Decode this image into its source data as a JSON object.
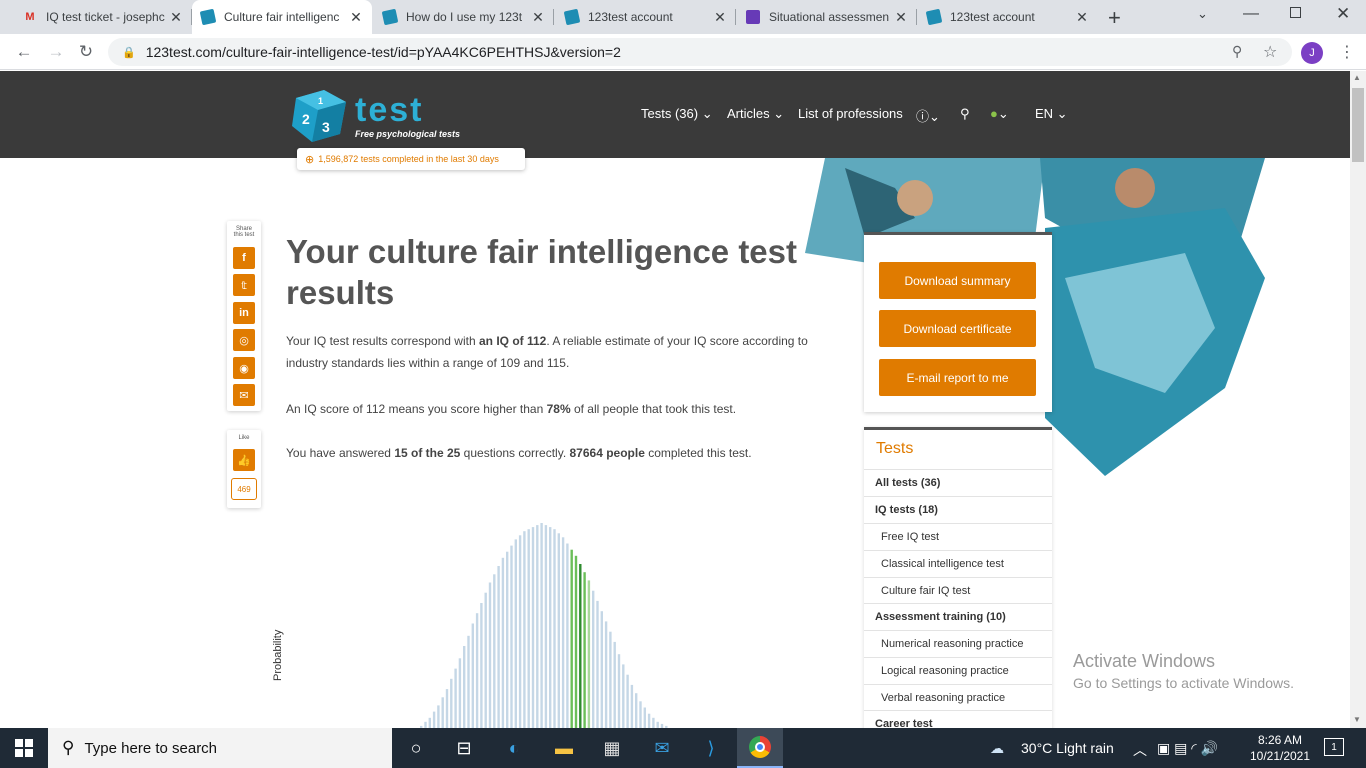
{
  "browser": {
    "tabs": [
      {
        "title": "IQ test ticket - josephc",
        "icon": "gmail-icon"
      },
      {
        "title": "Culture fair intelligenc",
        "icon": "123test-icon",
        "active": true
      },
      {
        "title": "How do I use my 123t",
        "icon": "123test-icon"
      },
      {
        "title": "123test account",
        "icon": "123test-icon"
      },
      {
        "title": "Situational assessmen",
        "icon": "forms-icon"
      },
      {
        "title": "123test account",
        "icon": "123test-icon"
      }
    ],
    "url": "123test.com/culture-fair-intelligence-test/id=pYAA4KC6PEHTHSJ&version=2",
    "profile_initial": "J"
  },
  "site": {
    "logo_text": "test",
    "logo_sub": "Free psychological tests",
    "counter": "1,596,872 tests completed in the last 30 days",
    "nav": {
      "tests": "Tests (36)",
      "articles": "Articles",
      "professions": "List of professions",
      "lang": "EN"
    }
  },
  "share": {
    "label1": "Share",
    "label2": "this test",
    "like_label": "Like",
    "like_count": "469"
  },
  "content": {
    "title": "Your culture fair intelligence test results",
    "p1_a": "Your IQ test results correspond with ",
    "p1_b": "an IQ of 112",
    "p1_c": ". A reliable estimate of your IQ score according to industry standards lies within a range of 109 and 115.",
    "p2_a": "An IQ score of 112 means you score higher than ",
    "p2_b": "78%",
    "p2_c": " of all people that took this test.",
    "p3_a": "You have answered ",
    "p3_b": "15 of the 25",
    "p3_c": " questions correctly. ",
    "p3_d": "87664 people",
    "p3_e": " completed this test.",
    "chart_ylabel": "Probability"
  },
  "buttons": {
    "download_summary": "Download summary",
    "download_certificate": "Download certificate",
    "email_report": "E-mail report to me"
  },
  "tests_panel": {
    "title": "Tests",
    "items": [
      {
        "label": "All tests (36)",
        "kind": "b"
      },
      {
        "label": "IQ tests (18)",
        "kind": "b"
      },
      {
        "label": "Free IQ test",
        "kind": "s"
      },
      {
        "label": "Classical intelligence test",
        "kind": "s"
      },
      {
        "label": "Culture fair IQ test",
        "kind": "s"
      },
      {
        "label": "Assessment training (10)",
        "kind": "b"
      },
      {
        "label": "Numerical reasoning practice",
        "kind": "s"
      },
      {
        "label": "Logical reasoning practice",
        "kind": "s"
      },
      {
        "label": "Verbal reasoning practice",
        "kind": "s"
      },
      {
        "label": "Career test",
        "kind": "b"
      }
    ]
  },
  "windows": {
    "activate_title": "Activate Windows",
    "activate_sub": "Go to Settings to activate Windows.",
    "search_placeholder": "Type here to search",
    "weather": "30°C  Light rain",
    "time": "8:26 AM",
    "date": "10/21/2021",
    "notif_count": "1"
  },
  "chart_data": {
    "type": "bar",
    "ylabel": "Probability",
    "bars": [
      0.01,
      0.03,
      0.05,
      0.08,
      0.11,
      0.15,
      0.19,
      0.24,
      0.29,
      0.34,
      0.4,
      0.45,
      0.51,
      0.56,
      0.61,
      0.66,
      0.71,
      0.75,
      0.79,
      0.83,
      0.86,
      0.89,
      0.92,
      0.94,
      0.96,
      0.97,
      0.98,
      0.99,
      1.0,
      0.99,
      0.98,
      0.97,
      0.95,
      0.93,
      0.9,
      0.87,
      0.84,
      0.8,
      0.76,
      0.72,
      0.67,
      0.62,
      0.57,
      0.52,
      0.47,
      0.42,
      0.36,
      0.31,
      0.26,
      0.21,
      0.17,
      0.13,
      0.1,
      0.07,
      0.05,
      0.03,
      0.02,
      0.01
    ],
    "highlight_start": 35,
    "dark_index": 37,
    "highlight_end": 39,
    "colors": {
      "normal": "#c5d7e6",
      "highlight": "#6bbf59",
      "dark": "#2e8b2e",
      "light": "#a8d89a"
    }
  }
}
